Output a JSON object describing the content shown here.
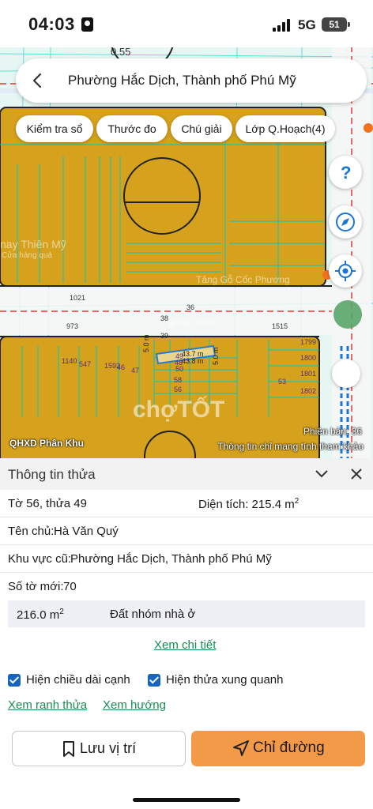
{
  "status": {
    "time": "04:03",
    "network": "5G",
    "battery": "51"
  },
  "header": {
    "title": "Phường Hắc Dịch, Thành phố Phú Mỹ"
  },
  "toolbar": {
    "chips": [
      "Kiểm tra sổ",
      "Thước đo",
      "Chú giải",
      "Lớp Q.Hoạch(4)"
    ]
  },
  "map": {
    "overlay_left": "QHXD Phân Khu",
    "version": "Phiên bản: 36",
    "disclaimer": "Thông tin chỉ mang tính tham khảo",
    "watermark_site": "ghviet.com",
    "watermark_brand": "chợTỐT",
    "poi_text": "nay Thiên Mỹ",
    "poi_sub": "Cửa hàng quà",
    "street_text": "Tảng Gỗ Cốc Phương",
    "circle_label": "0.55",
    "road_numbers": {
      "top": "1021",
      "left": "973",
      "right": "1515",
      "n36": "36",
      "n38": "38",
      "n39": "39"
    },
    "parcel_labels": [
      "1140",
      "547",
      "1592",
      "46",
      "47",
      "48",
      "49",
      "50",
      "58",
      "56",
      "53",
      "1799",
      "1800",
      "1801",
      "1802"
    ],
    "dimensions": {
      "side_a": "5.0 m",
      "side_b": "5.0 m",
      "len_a": "43.7 m",
      "len_b": "43.8 m"
    },
    "colors": {
      "parcel": "#d6a21d",
      "background": "#e6f6f2",
      "grid": "#00c8c0",
      "road": "#f7f7f7"
    }
  },
  "panel": {
    "title": "Thông tin thửa",
    "sheet": "Tờ 56, thửa 49",
    "area_label": "Diện tích:",
    "area_value": "215.4 m",
    "area_sup": "2",
    "owner_label": "Tên chủ:",
    "owner": "Hà Văn Quý",
    "old_area_label": "Khu vực cũ:",
    "old_area": "Phường Hắc Dịch, Thành phố Phú Mỹ",
    "new_sheet_label": "Số tờ mới:",
    "new_sheet": "70",
    "zone_area": "216.0 m",
    "zone_sup": "2",
    "zone_type": "Đất nhóm nhà ở",
    "details_link": "Xem chi tiết",
    "check_edges": "Hiện chiều dài cạnh",
    "check_neighbors": "Hiện thửa xung quanh",
    "link_boundary": "Xem ranh thửa",
    "link_direction": "Xem hướng",
    "btn_save": "Lưu vị trí",
    "btn_directions": "Chỉ đường"
  }
}
